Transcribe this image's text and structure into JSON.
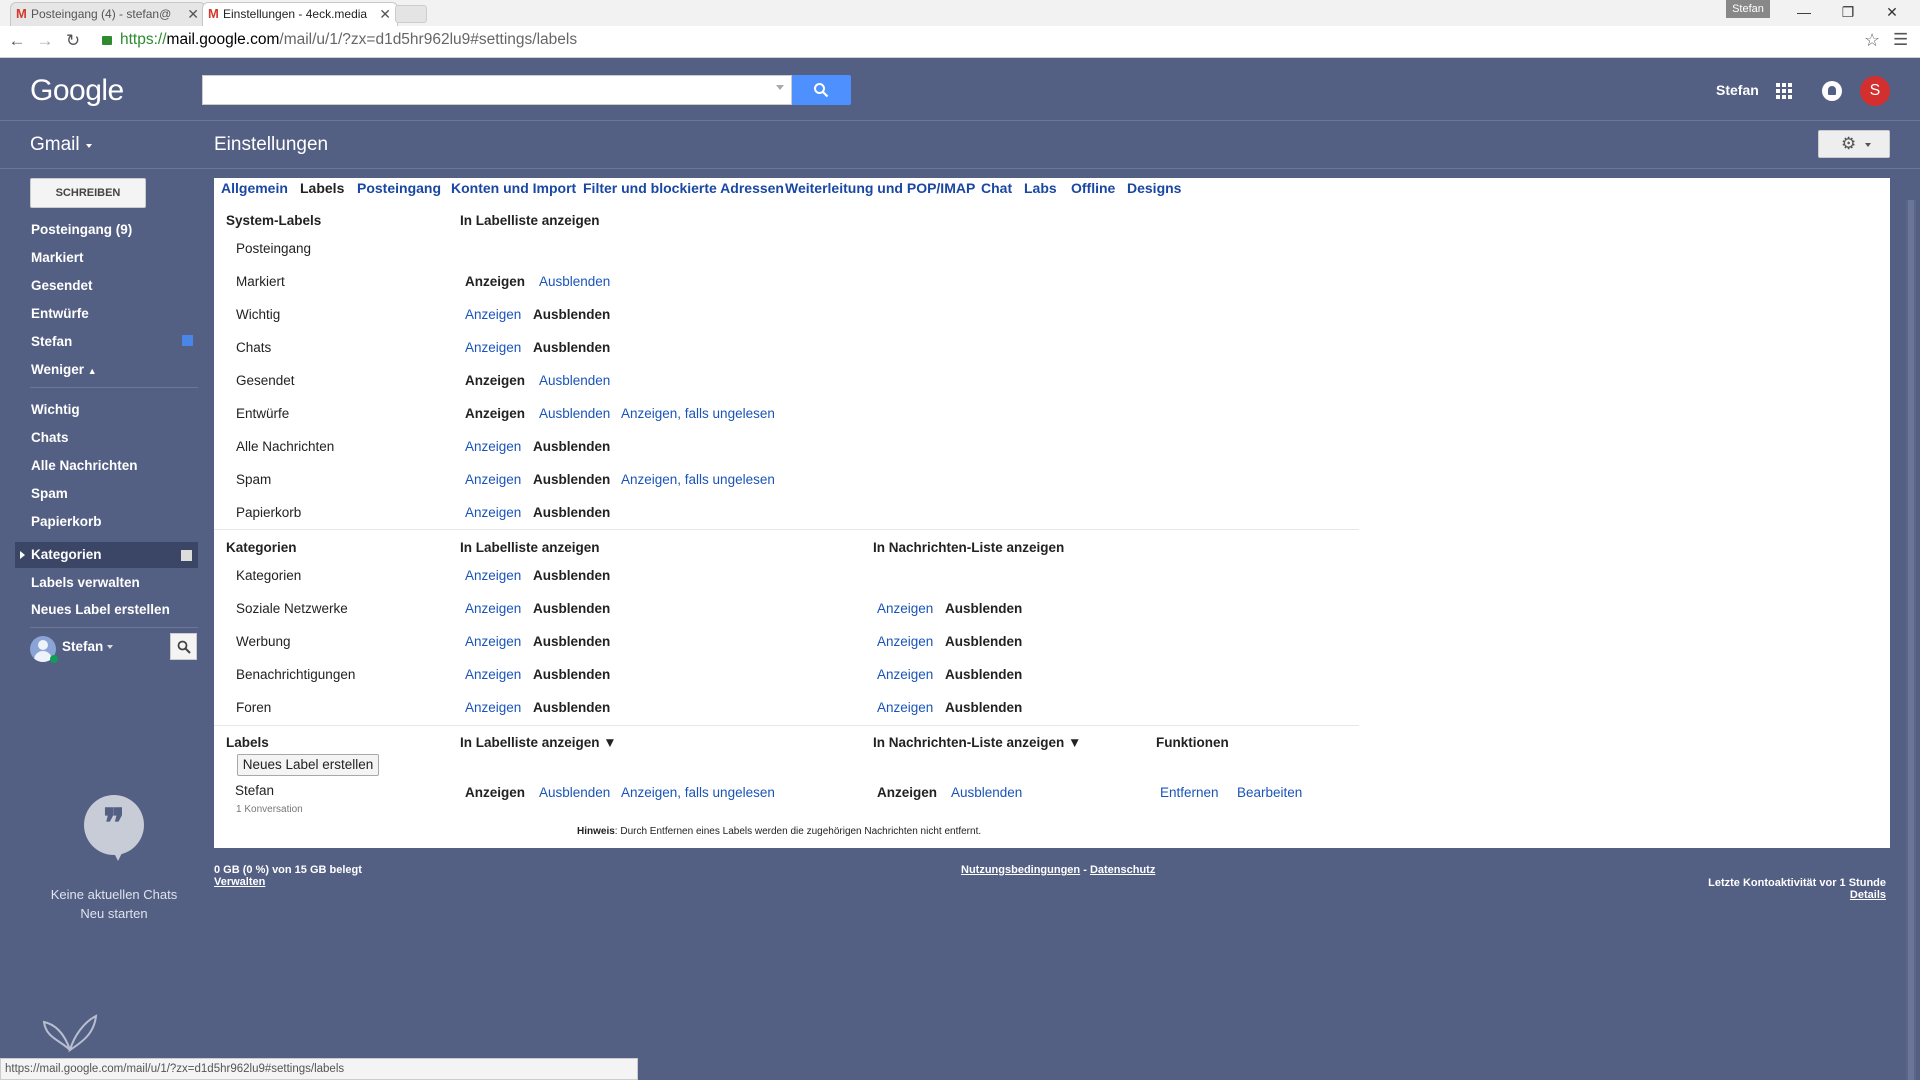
{
  "browser": {
    "tabs": [
      {
        "title": "Posteingang (4) - stefan@",
        "active": false
      },
      {
        "title": "Einstellungen - 4eck.media",
        "active": true
      }
    ],
    "user_chip": "Stefan",
    "url_scheme": "https://",
    "url_host": "mail.google.com",
    "url_path": "/mail/u/1/?zx=d1d5hr962lu9#settings/labels",
    "status_url": "https://mail.google.com/mail/u/1/?zx=d1d5hr962lu9#settings/labels"
  },
  "header": {
    "logo": "Google",
    "search_placeholder": "",
    "user_name": "Stefan",
    "avatar_letter": "S"
  },
  "gmail_label": "Gmail",
  "page_title": "Einstellungen",
  "nav": {
    "compose": "SCHREIBEN",
    "items": [
      "Posteingang (9)",
      "Markiert",
      "Gesendet",
      "Entwürfe",
      "Stefan",
      "Weniger"
    ],
    "items2": [
      "Wichtig",
      "Chats",
      "Alle Nachrichten",
      "Spam",
      "Papierkorb"
    ],
    "kategorien": "Kategorien",
    "items3": [
      "Labels verwalten",
      "Neues Label erstellen"
    ],
    "hangouts_user": "Stefan",
    "no_chats": "Keine aktuellen Chats",
    "restart": "Neu starten"
  },
  "settings_tabs": [
    "Allgemein",
    "Labels",
    "Posteingang",
    "Konten und Import",
    "Filter und blockierte Adressen",
    "Weiterleitung und POP/IMAP",
    "Chat",
    "Labs",
    "Offline",
    "Designs"
  ],
  "system": {
    "title": "System-Labels",
    "col_header": "In Labelliste anzeigen",
    "rows": [
      {
        "name": "Posteingang",
        "opts": []
      },
      {
        "name": "Markiert",
        "opts": [
          "Anzeigen",
          "Ausblenden"
        ],
        "sel": 0
      },
      {
        "name": "Wichtig",
        "opts": [
          "Anzeigen",
          "Ausblenden"
        ],
        "sel": 1
      },
      {
        "name": "Chats",
        "opts": [
          "Anzeigen",
          "Ausblenden"
        ],
        "sel": 1
      },
      {
        "name": "Gesendet",
        "opts": [
          "Anzeigen",
          "Ausblenden"
        ],
        "sel": 0
      },
      {
        "name": "Entwürfe",
        "opts": [
          "Anzeigen",
          "Ausblenden",
          "Anzeigen, falls ungelesen"
        ],
        "sel": 0
      },
      {
        "name": "Alle Nachrichten",
        "opts": [
          "Anzeigen",
          "Ausblenden"
        ],
        "sel": 1
      },
      {
        "name": "Spam",
        "opts": [
          "Anzeigen",
          "Ausblenden",
          "Anzeigen, falls ungelesen"
        ],
        "sel": 1
      },
      {
        "name": "Papierkorb",
        "opts": [
          "Anzeigen",
          "Ausblenden"
        ],
        "sel": 1
      }
    ]
  },
  "categories": {
    "title": "Kategorien",
    "col_header": "In Labelliste anzeigen",
    "col_header2": "In Nachrichten-Liste anzeigen",
    "rows": [
      {
        "name": "Kategorien",
        "opts": [
          "Anzeigen",
          "Ausblenden"
        ],
        "sel": 1,
        "opts2": [],
        "sel2": -1
      },
      {
        "name": "Soziale Netzwerke",
        "opts": [
          "Anzeigen",
          "Ausblenden"
        ],
        "sel": 1,
        "opts2": [
          "Anzeigen",
          "Ausblenden"
        ],
        "sel2": 1
      },
      {
        "name": "Werbung",
        "opts": [
          "Anzeigen",
          "Ausblenden"
        ],
        "sel": 1,
        "opts2": [
          "Anzeigen",
          "Ausblenden"
        ],
        "sel2": 1
      },
      {
        "name": "Benachrichtigungen",
        "opts": [
          "Anzeigen",
          "Ausblenden"
        ],
        "sel": 1,
        "opts2": [
          "Anzeigen",
          "Ausblenden"
        ],
        "sel2": 1
      },
      {
        "name": "Foren",
        "opts": [
          "Anzeigen",
          "Ausblenden"
        ],
        "sel": 1,
        "opts2": [
          "Anzeigen",
          "Ausblenden"
        ],
        "sel2": 1
      }
    ]
  },
  "labels": {
    "title": "Labels",
    "col_header": "In Labelliste anzeigen ▼",
    "col_header2": "In Nachrichten-Liste anzeigen ▼",
    "col_header3": "Funktionen",
    "new_label_btn": "Neues Label erstellen",
    "rows": [
      {
        "name": "Stefan",
        "sub": "1 Konversation",
        "opts": [
          "Anzeigen",
          "Ausblenden",
          "Anzeigen, falls ungelesen"
        ],
        "sel": 0,
        "opts2": [
          "Anzeigen",
          "Ausblenden"
        ],
        "sel2": 0,
        "funcs": [
          "Entfernen",
          "Bearbeiten"
        ]
      }
    ],
    "hint_bold": "Hinweis",
    "hint_text": ": Durch Entfernen eines Labels werden die zugehörigen Nachrichten nicht entfernt."
  },
  "footer": {
    "storage": "0 GB (0 %) von 15 GB belegt",
    "manage": "Verwalten",
    "terms": "Nutzungsbedingungen",
    "sep": " - ",
    "privacy": "Datenschutz",
    "last_activity": "Letzte Kontoaktivität vor 1 Stunde",
    "details": "Details"
  }
}
